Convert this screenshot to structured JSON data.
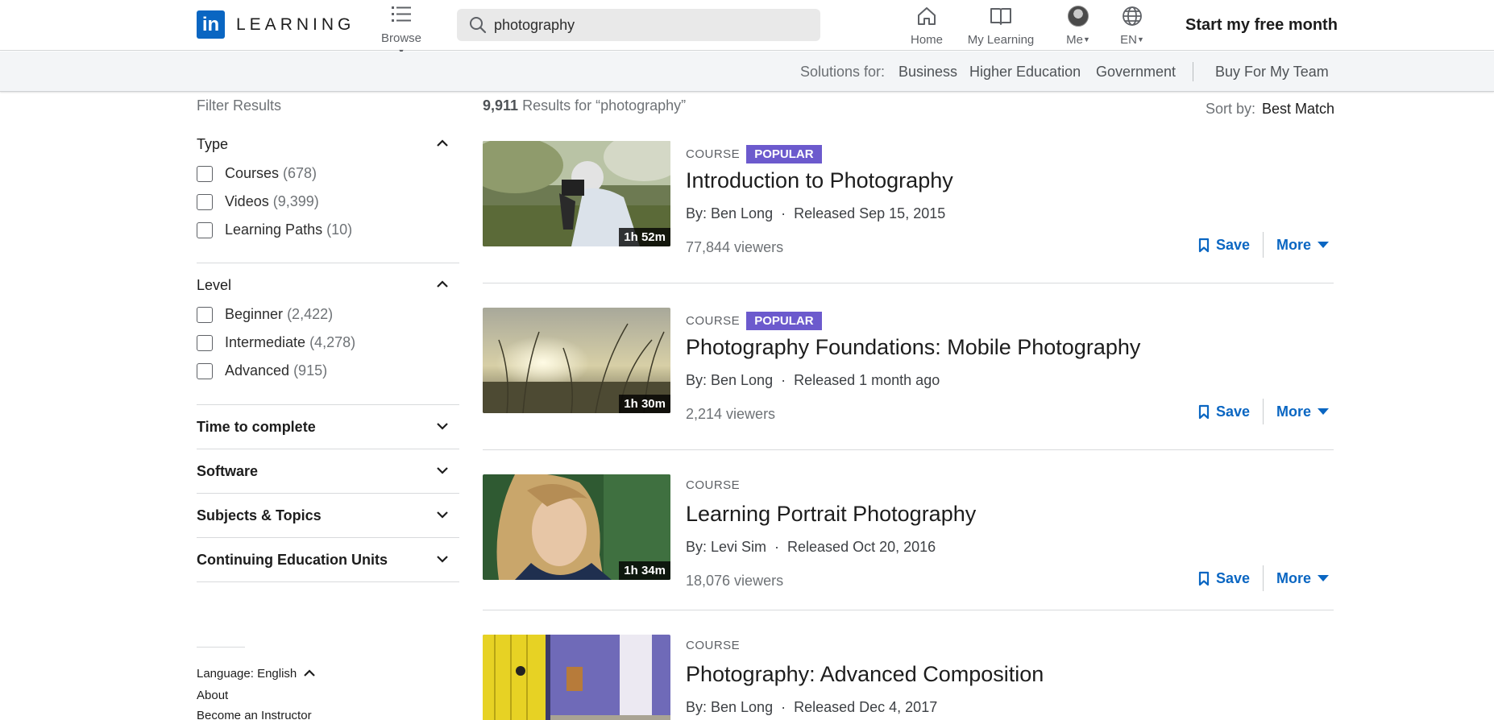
{
  "header": {
    "logo_letters": "in",
    "logo_text": "LEARNING",
    "browse_label": "Browse",
    "search_value": "photography",
    "nav": {
      "home": "Home",
      "my_learning": "My Learning",
      "me": "Me",
      "language": "EN"
    },
    "cta": "Start my free month"
  },
  "subbar": {
    "solutions_label": "Solutions for:",
    "business": "Business",
    "higher_education": "Higher Education",
    "government": "Government",
    "buy_for_team": "Buy For My Team"
  },
  "filters": {
    "title": "Filter Results",
    "type": {
      "heading": "Type",
      "options": [
        {
          "label": "Courses",
          "count": "(678)"
        },
        {
          "label": "Videos",
          "count": "(9,399)"
        },
        {
          "label": "Learning Paths",
          "count": "(10)"
        }
      ]
    },
    "level": {
      "heading": "Level",
      "options": [
        {
          "label": "Beginner",
          "count": "(2,422)"
        },
        {
          "label": "Intermediate",
          "count": "(4,278)"
        },
        {
          "label": "Advanced",
          "count": "(915)"
        }
      ]
    },
    "collapsed": [
      "Time to complete",
      "Software",
      "Subjects & Topics",
      "Continuing Education Units"
    ],
    "footer": {
      "language": "Language: English",
      "about": "About",
      "become_instructor": "Become an Instructor"
    }
  },
  "results": {
    "count": "9,911",
    "count_suffix": "Results for “photography”",
    "sort_label": "Sort by:",
    "sort_value": "Best Match",
    "save_label": "Save",
    "more_label": "More",
    "items": [
      {
        "kind": "COURSE",
        "badge": "POPULAR",
        "title": "Introduction to Photography",
        "author": "By: Ben Long",
        "released": "Released Sep 15, 2015",
        "viewers": "77,844 viewers",
        "duration": "1h 52m"
      },
      {
        "kind": "COURSE",
        "badge": "POPULAR",
        "title": "Photography Foundations: Mobile Photography",
        "author": "By: Ben Long",
        "released": "Released 1 month ago",
        "viewers": "2,214 viewers",
        "duration": "1h 30m"
      },
      {
        "kind": "COURSE",
        "badge": "",
        "title": "Learning Portrait Photography",
        "author": "By: Levi Sim",
        "released": "Released Oct 20, 2016",
        "viewers": "18,076 viewers",
        "duration": "1h 34m"
      },
      {
        "kind": "COURSE",
        "badge": "",
        "title": "Photography: Advanced Composition",
        "author": "By: Ben Long",
        "released": "Released Dec 4, 2017",
        "viewers": "",
        "duration": ""
      }
    ]
  },
  "colors": {
    "brand_blue": "#0a66c2",
    "popular_badge": "#6c5acd"
  }
}
